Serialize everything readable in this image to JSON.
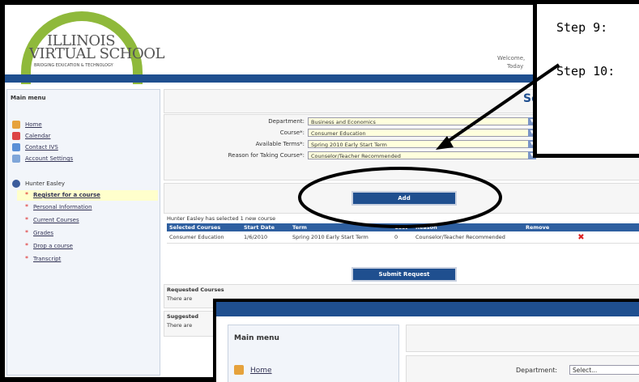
{
  "header": {
    "logo_line1": "ILLINOIS",
    "logo_line2": "VIRTUAL SCHOOL",
    "logo_tagline": "BRIDGING EDUCATION & TECHNOLOGY",
    "welcome": "Welcome,",
    "today": "Today"
  },
  "sidebar": {
    "title": "Main menu",
    "links": [
      {
        "label": "Home",
        "icon": "home-icon"
      },
      {
        "label": "Calendar",
        "icon": "calendar-icon"
      },
      {
        "label": "Contact IVS",
        "icon": "contact-icon"
      },
      {
        "label": "Account Settings",
        "icon": "settings-icon"
      }
    ],
    "user": "Hunter Easley",
    "sub_links": [
      "Register for a course",
      "Personal Information",
      "Current Courses",
      "Grades",
      "Drop a course",
      "Transcript"
    ]
  },
  "main": {
    "heading_partial": "Se",
    "form": {
      "department_label": "Department:",
      "department_value": "Business and Economics",
      "course_label": "Course*:",
      "course_value": "Consumer Education",
      "term_label": "Available Terms*:",
      "term_value": "Spring 2010 Early Start Term",
      "reason_label": "Reason for Taking Course*:",
      "reason_value": "Counselor/Teacher Recommended"
    },
    "add_button": "Add",
    "selected_note": "Hunter Easley has selected 1 new course",
    "table": {
      "headers": [
        "Selected Courses",
        "Start Date",
        "Term",
        "Cost",
        "Reason",
        "Remove"
      ],
      "rows": [
        [
          "Consumer Education",
          "1/6/2010",
          "Spring 2010 Early Start Term",
          "0",
          "Counselor/Teacher Recommended",
          "✖"
        ]
      ]
    },
    "submit_button": "Submit Request",
    "requested_title": "Requested Courses",
    "requested_text": "There are",
    "suggested_title": "Suggested",
    "suggested_text": "There are"
  },
  "callout": {
    "step9": "Step 9:",
    "step10": "Step 10:"
  },
  "inset": {
    "menu_title": "Main menu",
    "home": "Home",
    "department_label": "Department:",
    "department_value": "Select..."
  },
  "colors": {
    "brand_blue": "#1f4f8f",
    "logo_green": "#8fb93b",
    "field_bg": "#ffffdd"
  }
}
